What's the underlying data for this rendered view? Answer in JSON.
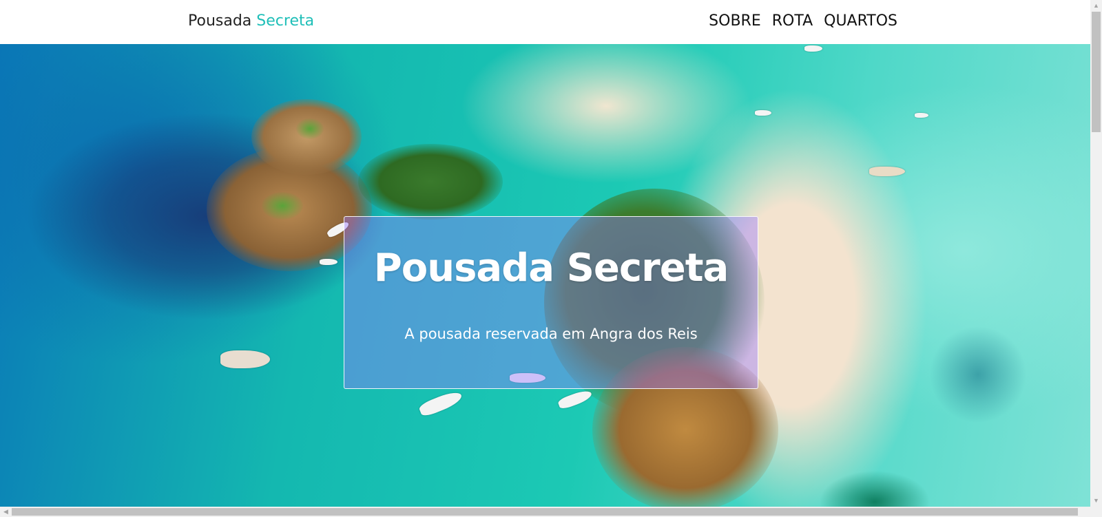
{
  "navbar": {
    "brand_main": "Pousada",
    "brand_accent": "Secreta",
    "links": [
      "SOBRE",
      "ROTA",
      "QUARTOS"
    ]
  },
  "hero": {
    "title": "Pousada Secreta",
    "subtitle": "A pousada reservada em Angra dos Reis",
    "image": "aerial-beach-islands-photo"
  },
  "colors": {
    "brand_accent": "#1fbfb8",
    "card_overlay": "#9678ff"
  },
  "icons": {
    "scroll_up": "▲",
    "scroll_down": "▼",
    "scroll_left": "◀"
  }
}
